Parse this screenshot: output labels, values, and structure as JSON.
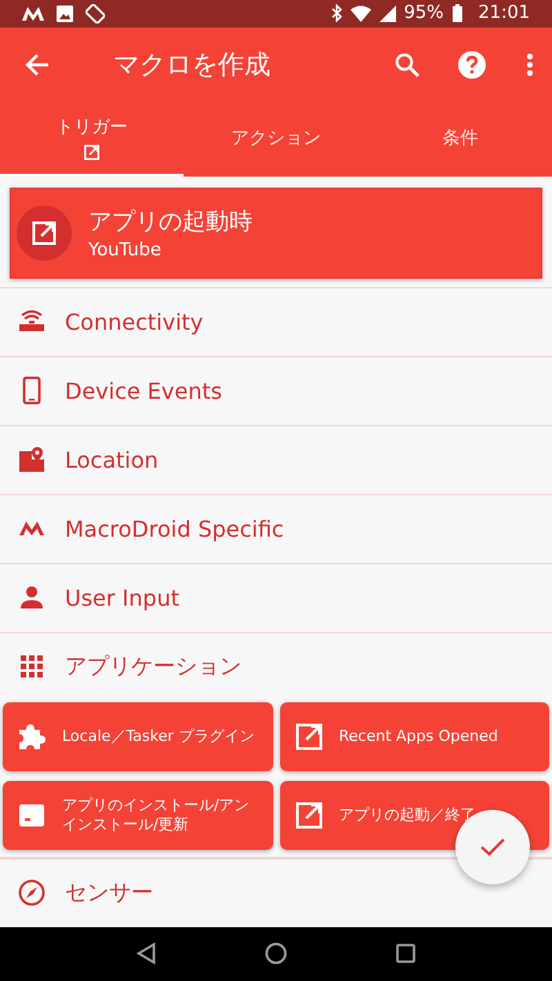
{
  "status_bar": {
    "battery": "95%",
    "time": "21:01"
  },
  "toolbar": {
    "title": "マクロを作成"
  },
  "tabs": [
    {
      "label": "トリガー",
      "selected": true
    },
    {
      "label": "アクション",
      "selected": false
    },
    {
      "label": "条件",
      "selected": false
    }
  ],
  "selected_trigger": {
    "title": "アプリの起動時",
    "subtitle": "YouTube"
  },
  "categories": [
    {
      "label": "Connectivity"
    },
    {
      "label": "Device Events"
    },
    {
      "label": "Location"
    },
    {
      "label": "MacroDroid Specific"
    },
    {
      "label": "User Input"
    },
    {
      "label": "アプリケーション",
      "options": [
        "Locale／Tasker プラグイン",
        "Recent Apps Opened",
        "アプリのインストール/アンインストール/更新",
        "アプリの起動／終了"
      ]
    },
    {
      "label": "センサー"
    }
  ]
}
